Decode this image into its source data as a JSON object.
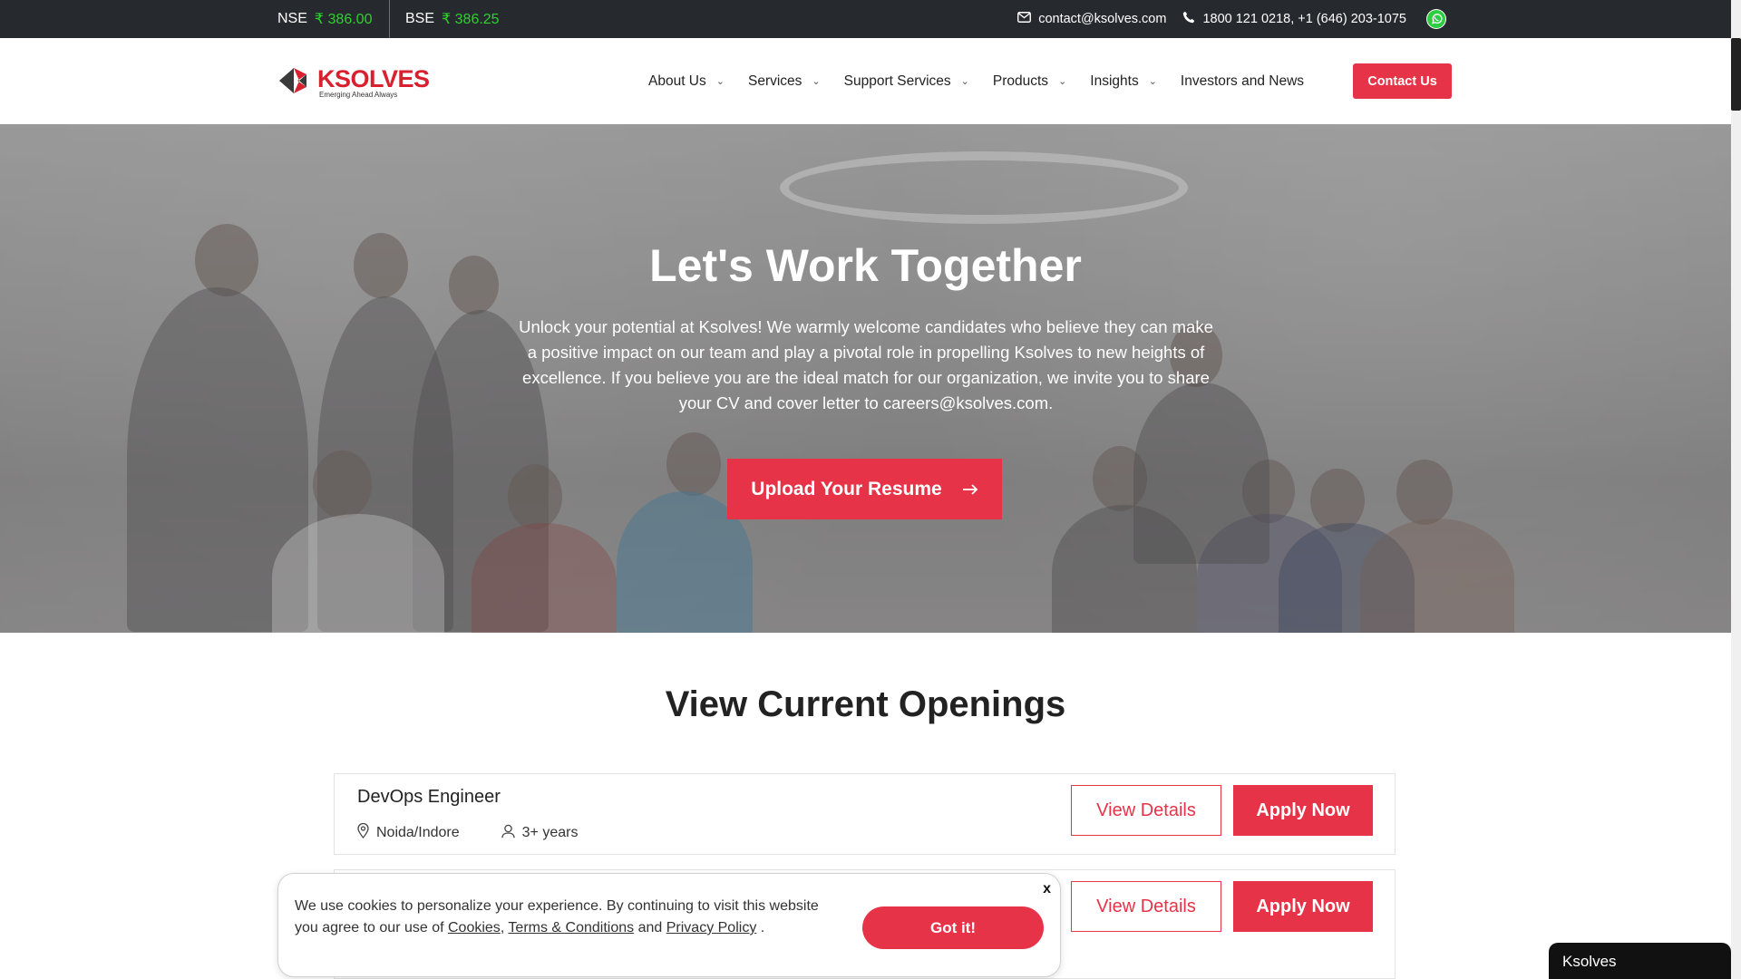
{
  "topbar": {
    "nse_label": "NSE",
    "nse_value": "₹ 386.00",
    "bse_label": "BSE",
    "bse_value": "₹ 386.25",
    "email": "contact@ksolves.com",
    "phone": "1800 121 0218,  +1 (646) 203-1075",
    "icons": [
      "mail-icon",
      "phone-icon",
      "whatsapp-icon"
    ]
  },
  "header": {
    "logo_name": "KSOLVES",
    "logo_tagline": "Emerging Ahead Always",
    "nav": [
      {
        "label": "About Us",
        "has_dropdown": true
      },
      {
        "label": "Services",
        "has_dropdown": true
      },
      {
        "label": "Support Services",
        "has_dropdown": true
      },
      {
        "label": "Products",
        "has_dropdown": true
      },
      {
        "label": "Insights",
        "has_dropdown": true
      },
      {
        "label": "Investors and News",
        "has_dropdown": false
      }
    ],
    "contact_button": "Contact Us"
  },
  "hero": {
    "title": "Let's Work Together",
    "text": "Unlock your potential at Ksolves! We warmly welcome candidates who believe they can make a positive impact on our team and play a pivotal role in propelling Ksolves to new heights of excellence. If you believe you are the ideal match for our organization, we invite you to share your CV and cover letter to careers@ksolves.com.",
    "button": "Upload Your Resume",
    "button_icon": "arrow-right-icon"
  },
  "openings": {
    "title": "View Current Openings",
    "jobs": [
      {
        "title": "DevOps Engineer",
        "location": "Noida/Indore",
        "experience": "3+ years",
        "view": "View Details",
        "apply": "Apply Now"
      },
      {
        "title": "",
        "location": "",
        "experience": "",
        "view": "View Details",
        "apply": "Apply Now"
      }
    ]
  },
  "cookie": {
    "text_before": "We use cookies to personalize your experience. By continuing to visit this website you agree to our use of ",
    "cookies_link": "Cookies",
    "separator": ", ",
    "terms_link": "Terms & Conditions",
    "and_text": " and ",
    "privacy_link": "Privacy Policy",
    "end_text": " .",
    "close": "x",
    "button": "Got it!"
  },
  "chat": {
    "label": "Ksolves"
  },
  "colors": {
    "accent": "#e63347",
    "topbar_bg": "#26292e",
    "stock_green": "#2ed12e"
  }
}
